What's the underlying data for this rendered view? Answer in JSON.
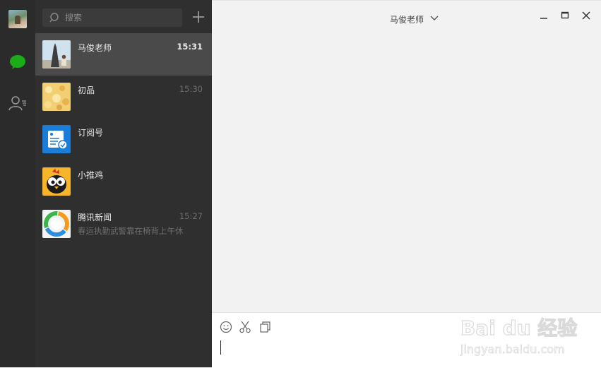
{
  "search": {
    "placeholder": "搜索"
  },
  "conversations": [
    {
      "name": "马俊老师",
      "time": "15:31",
      "message": ""
    },
    {
      "name": "初品",
      "time": "15:30",
      "message": ""
    },
    {
      "name": "订阅号",
      "time": "",
      "message": ""
    },
    {
      "name": "小推鸡",
      "time": "",
      "message": ""
    },
    {
      "name": "腾讯新闻",
      "time": "15:27",
      "message": "春运执勤武警靠在椅背上午休"
    }
  ],
  "chat": {
    "title": "马俊老师"
  },
  "icons": {
    "rail": [
      "avatar",
      "chat-icon",
      "contacts-icon"
    ],
    "toolbar": [
      "emoji-icon",
      "scissors-icon",
      "file-icon"
    ],
    "window": [
      "minimize-icon",
      "maximize-icon",
      "close-icon"
    ]
  },
  "colors": {
    "rail_bg": "#2b2b2c",
    "list_bg": "#2f2f2f",
    "active_item": "#4a4a4a",
    "chat_active_icon": "#1aad19",
    "chat_bg": "#f2f2f2"
  },
  "watermark": {
    "brand": "Bai du 经验",
    "url": "jingyan.baidu.com"
  }
}
